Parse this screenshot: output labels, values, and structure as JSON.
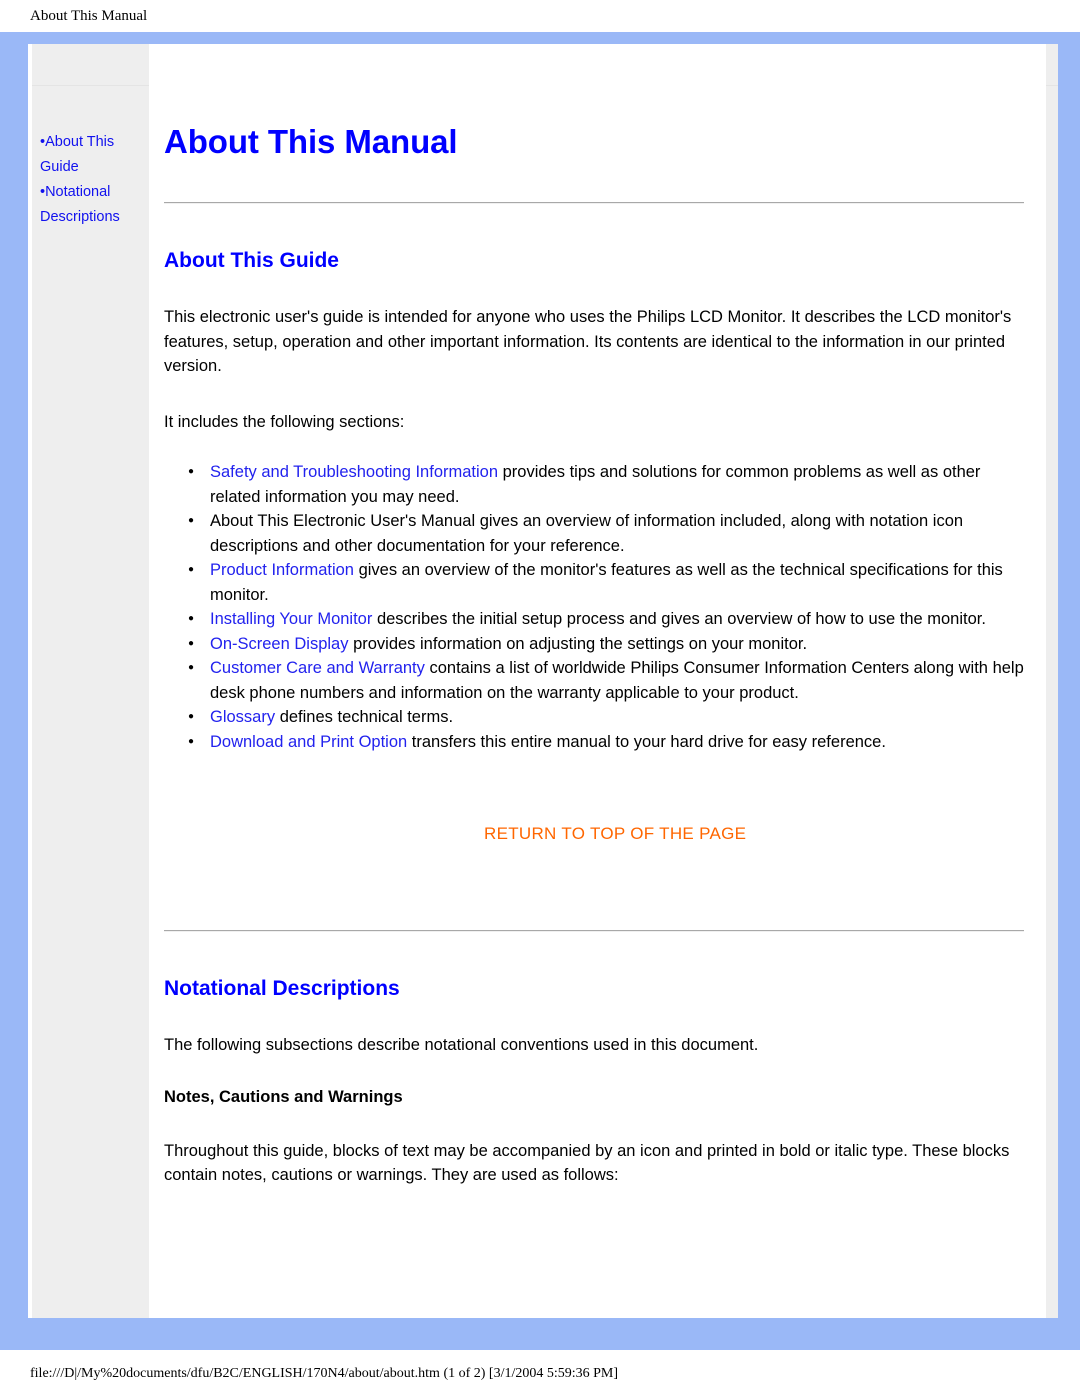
{
  "page": {
    "header_title": "About This Manual",
    "footer_text": "file:///D|/My%20documents/dfu/B2C/ENGLISH/170N4/about/about.htm (1 of 2) [3/1/2004 5:59:36 PM]"
  },
  "colors": {
    "frame_blue": "#9ab8f7",
    "sidebar_gray": "#eeeeee",
    "heading_blue": "#0000ff",
    "link_blue": "#2222ee",
    "return_orange": "#ff6600",
    "body_black": "#000000"
  },
  "sidebar": {
    "bullet": "•",
    "items": [
      {
        "label": "About This Guide"
      },
      {
        "label": "Notational Descriptions"
      }
    ]
  },
  "main": {
    "title": "About This Manual",
    "section1": {
      "heading": "About This Guide",
      "paragraph1": "This electronic user's guide is intended for anyone who uses the Philips LCD Monitor. It describes the LCD monitor's features, setup, operation and other important information. Its contents are identical to the information in our printed version.",
      "paragraph2": "It includes the following sections:",
      "bullets": [
        {
          "link": "Safety and Troubleshooting Information",
          "text": " provides tips and solutions for common problems as well as other related information you may need."
        },
        {
          "link": "",
          "text": "About This Electronic User's Manual gives an overview of information included, along with notation icon descriptions and other documentation for your reference."
        },
        {
          "link": "Product Information",
          "text": " gives an overview of the monitor's features as well as the technical specifications for this monitor."
        },
        {
          "link": "Installing Your Monitor",
          "text": " describes the initial setup process and gives an overview of how to use the monitor."
        },
        {
          "link": "On-Screen Display",
          "text": " provides information on adjusting the settings on your monitor."
        },
        {
          "link": "Customer Care and Warranty",
          "text": " contains a list of worldwide Philips Consumer Information Centers along with help desk phone numbers and information on the warranty applicable to your product."
        },
        {
          "link": "Glossary",
          "text": " defines technical terms."
        },
        {
          "link": "Download and Print Option",
          "text": " transfers this entire manual to your hard drive for easy reference."
        }
      ],
      "return_to_top": "RETURN TO TOP OF THE PAGE"
    },
    "section2": {
      "heading": "Notational Descriptions",
      "paragraph1": "The following subsections describe notational conventions used in this document.",
      "subheading": "Notes, Cautions and Warnings",
      "paragraph2": "Throughout this guide, blocks of text may be accompanied by an icon and printed in bold or italic type. These blocks contain notes, cautions or warnings. They are used as follows:"
    }
  }
}
